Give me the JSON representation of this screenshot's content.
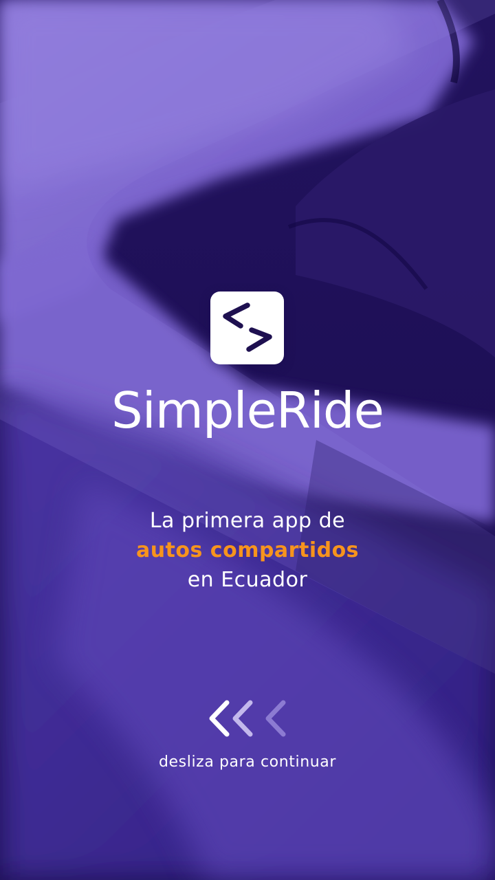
{
  "splash": {
    "app_name": "SimpleRide",
    "tagline": {
      "line1": "La primera app de",
      "highlight": "autos compartidos",
      "line3": "en Ecuador"
    },
    "swipe_hint": "desliza para continuar",
    "logo_icon": "code-brackets-icon",
    "swipe_icon": "triple-chevron-left-icon"
  },
  "colors": {
    "background": "#1c0f56",
    "overlay_violet": "#6e55c4",
    "accent": "#f7941d",
    "text": "#ffffff"
  }
}
